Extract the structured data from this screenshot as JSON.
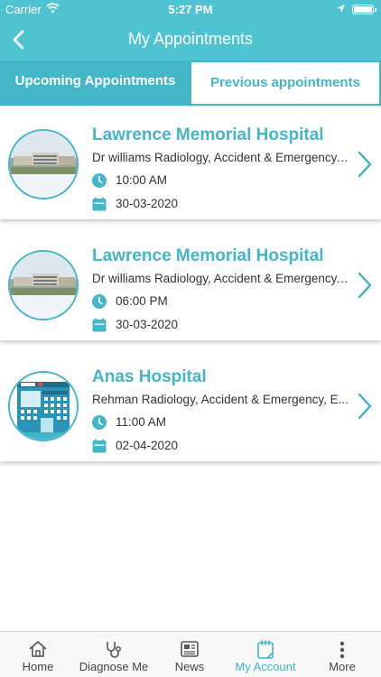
{
  "status_bar": {
    "carrier": "Carrier",
    "time": "5:27 PM"
  },
  "nav": {
    "title": "My Appointments"
  },
  "tabs": {
    "upcoming": "Upcoming Appointments",
    "previous": "Previous appointments",
    "active": "previous"
  },
  "appointments": [
    {
      "hospital": "Lawrence Memorial Hospital",
      "details": "Dr williams  Radiology, Accident & Emergency,...",
      "time": "10:00 AM",
      "date": "30-03-2020",
      "image": "hospital-photo"
    },
    {
      "hospital": "Lawrence Memorial Hospital",
      "details": "Dr williams  Radiology, Accident & Emergency,...",
      "time": "06:00 PM",
      "date": "30-03-2020",
      "image": "hospital-photo"
    },
    {
      "hospital": "Anas Hospital",
      "details": "Rehman  Radiology, Accident & Emergency, E...",
      "time": "11:00 AM",
      "date": "02-04-2020",
      "image": "hospital-illustration"
    }
  ],
  "tab_bar": {
    "items": [
      {
        "label": "Home",
        "icon": "home-icon"
      },
      {
        "label": "Diagnose Me",
        "icon": "stethoscope-icon"
      },
      {
        "label": "News",
        "icon": "news-icon"
      },
      {
        "label": "My Account",
        "icon": "notepad-icon"
      },
      {
        "label": "More",
        "icon": "more-dots-icon"
      }
    ],
    "active": "My Account"
  },
  "colors": {
    "accent": "#43b6c8",
    "header": "#4fc3d2",
    "text": "#333333"
  }
}
